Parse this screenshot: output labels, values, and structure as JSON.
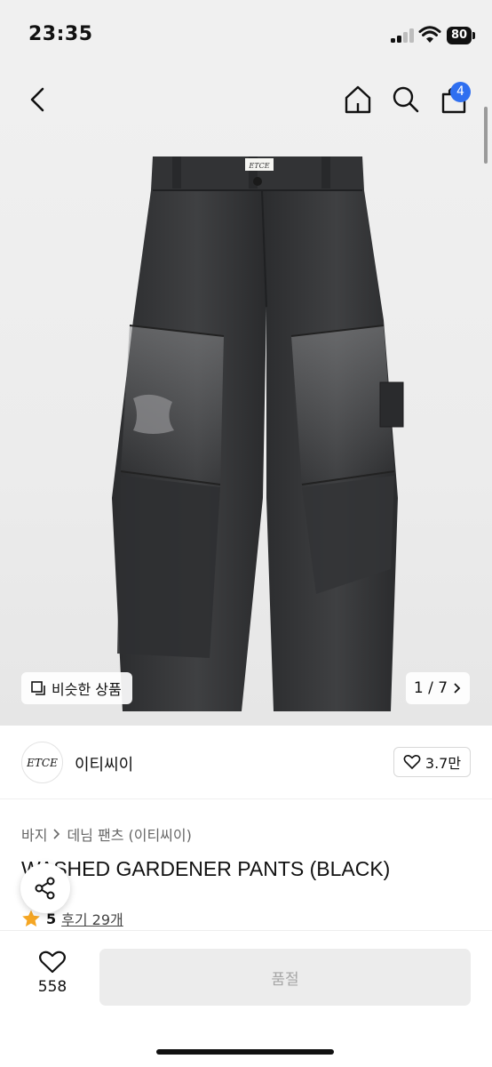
{
  "status_bar": {
    "time": "23:35",
    "battery": "80"
  },
  "header": {
    "cart_count": "4"
  },
  "product_image": {
    "label": "ETCE"
  },
  "gallery": {
    "similar_label": "비슷한 상품",
    "pager": "1 / 7"
  },
  "brand": {
    "logo_text": "ETCE",
    "name": "이티씨이",
    "likes": "3.7만"
  },
  "breadcrumb": [
    "바지",
    "데님 팬츠 (이티씨이)"
  ],
  "product": {
    "title": "WASHED GARDENER PANTS (BLACK)",
    "rating": "5",
    "reviews": "후기 29개"
  },
  "bottom_bar": {
    "wish_count": "558",
    "buy_label": "품절"
  },
  "colors": {
    "badge": "#2f6ff0",
    "star": "#f5a623",
    "denim": "#2e2f31"
  }
}
